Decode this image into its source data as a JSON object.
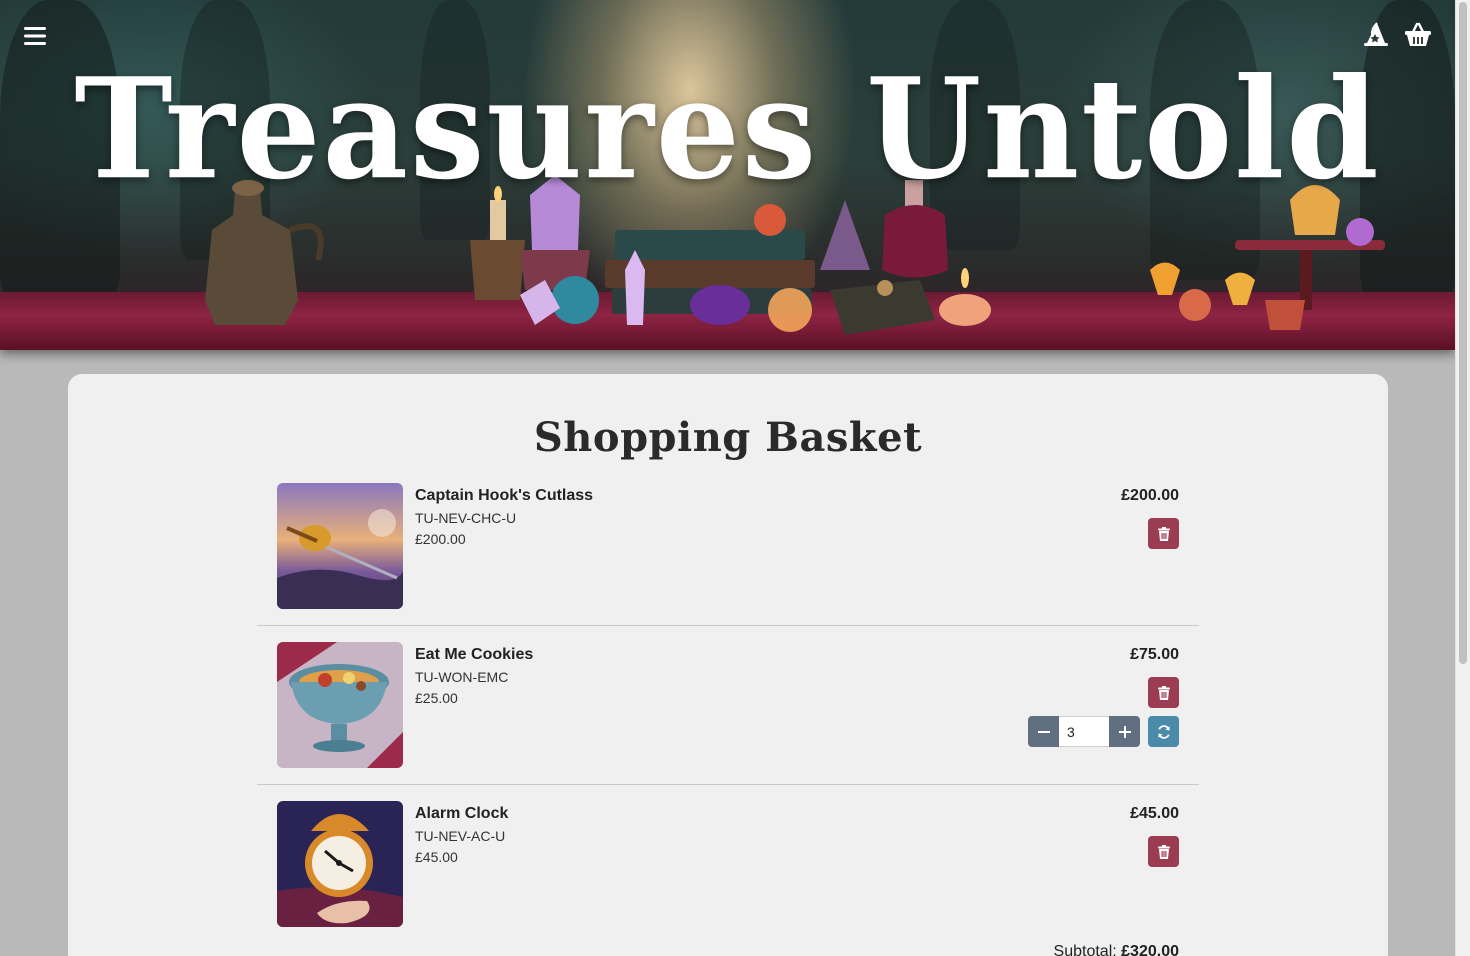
{
  "header": {
    "site_title": "Treasures Untold",
    "menu_icon": "hamburger-menu-icon",
    "account_icon": "wizard-hat-icon",
    "basket_icon": "shopping-basket-icon"
  },
  "basket": {
    "title": "Shopping Basket",
    "items": [
      {
        "name": "Captain Hook's Cutlass",
        "sku": "TU-NEV-CHC-U",
        "unit_price": "£200.00",
        "line_total": "£200.00",
        "image_subject": "cutlass-image"
      },
      {
        "name": "Eat Me Cookies",
        "sku": "TU-WON-EMC",
        "unit_price": "£25.00",
        "line_total": "£75.00",
        "quantity": "3",
        "image_subject": "cookies-image"
      },
      {
        "name": "Alarm Clock",
        "sku": "TU-NEV-AC-U",
        "unit_price": "£45.00",
        "line_total": "£45.00",
        "image_subject": "alarm-clock-image"
      }
    ],
    "subtotal_label": "Subtotal:",
    "subtotal_value": "£320.00"
  },
  "colors": {
    "delete": "#9c3c52",
    "stepper": "#607080",
    "refresh": "#4b8aa8",
    "card": "#f0f0f0",
    "page": "#b9b9b9"
  }
}
